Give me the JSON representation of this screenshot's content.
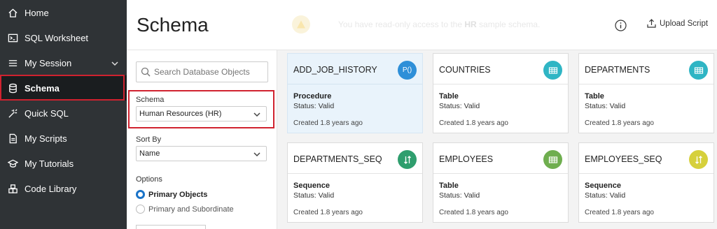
{
  "sidebar": {
    "items": [
      {
        "label": "Home",
        "icon": "home-icon"
      },
      {
        "label": "SQL Worksheet",
        "icon": "terminal-icon"
      },
      {
        "label": "My Session",
        "icon": "menu-icon"
      },
      {
        "label": "Schema",
        "icon": "database-icon"
      },
      {
        "label": "Quick SQL",
        "icon": "wand-icon"
      },
      {
        "label": "My Scripts",
        "icon": "document-icon"
      },
      {
        "label": "My Tutorials",
        "icon": "graduation-cap-icon"
      },
      {
        "label": "Code Library",
        "icon": "blocks-icon"
      }
    ],
    "active_index": 3
  },
  "header": {
    "title": "Schema",
    "banner_prefix": "You have read-only access to the ",
    "banner_bold": "HR",
    "banner_suffix": " sample schema.",
    "upload_label": "Upload Script"
  },
  "filter": {
    "search_placeholder": "Search Database Objects",
    "schema_label": "Schema",
    "schema_value": "Human Resources (HR)",
    "sort_label": "Sort By",
    "sort_value": "Name",
    "options_label": "Options",
    "option_primary": "Primary Objects",
    "option_subordinate": "Primary and Subordinate",
    "selected_option": "Primary Objects"
  },
  "cards": [
    {
      "name": "ADD_JOB_HISTORY",
      "type": "Procedure",
      "status": "Status: Valid",
      "created": "Created 1.8 years ago",
      "badge": "P()",
      "badge_icon": "procedure-icon",
      "badge_color": "#2e8fd8"
    },
    {
      "name": "COUNTRIES",
      "type": "Table",
      "status": "Status: Valid",
      "created": "Created 1.8 years ago",
      "badge": "",
      "badge_icon": "table-icon",
      "badge_color": "#2fb5c4"
    },
    {
      "name": "DEPARTMENTS",
      "type": "Table",
      "status": "Status: Valid",
      "created": "Created 1.8 years ago",
      "badge": "",
      "badge_icon": "table-icon",
      "badge_color": "#2fb5c4"
    },
    {
      "name": "DEPARTMENTS_SEQ",
      "type": "Sequence",
      "status": "Status: Valid",
      "created": "Created 1.8 years ago",
      "badge": "",
      "badge_icon": "sequence-icon",
      "badge_color": "#2f9e6e"
    },
    {
      "name": "EMPLOYEES",
      "type": "Table",
      "status": "Status: Valid",
      "created": "Created 1.8 years ago",
      "badge": "",
      "badge_icon": "table-icon",
      "badge_color": "#6fae4f"
    },
    {
      "name": "EMPLOYEES_SEQ",
      "type": "Sequence",
      "status": "Status: Valid",
      "created": "Created 1.8 years ago",
      "badge": "",
      "badge_icon": "sequence-icon",
      "badge_color": "#d6d03c"
    }
  ],
  "colors": {
    "sidebar_bg": "#2f3336",
    "highlight": "#d0222f",
    "selected_card": "#e9f3fb",
    "radio_accent": "#1a73c8"
  }
}
